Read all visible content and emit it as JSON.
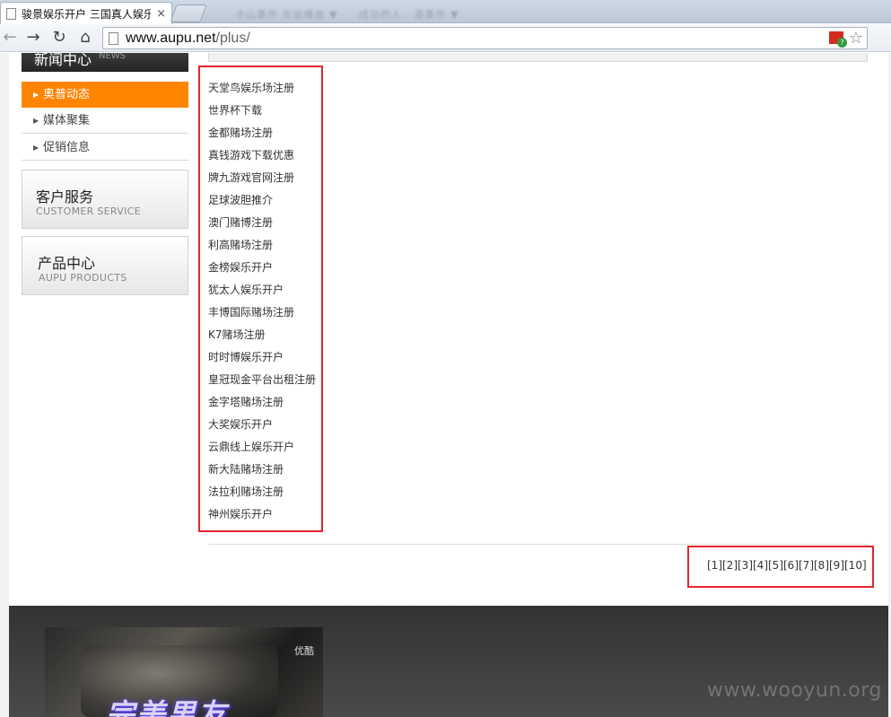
{
  "browser": {
    "tab_title": "骏景娱乐开户 三国真人娱乐",
    "tab_close": "×",
    "ghost_tabs": [
      "卡山事件 车运播放 ▼",
      "成功的人 · 道事件 ▼"
    ],
    "back": "←",
    "forward": "→",
    "reload": "↻",
    "home": "⌂",
    "url_host": "www.aupu.net",
    "url_path": "/plus/",
    "bookmark_star": "☆",
    "more": "»"
  },
  "sidebar": {
    "news_title": "新闻中心",
    "news_title_en": "NEWS",
    "items": [
      {
        "label": "奥普动态",
        "active": true
      },
      {
        "label": "媒体聚集",
        "active": false
      },
      {
        "label": "促销信息",
        "active": false
      }
    ],
    "service": {
      "title": "客户服务",
      "subtitle": "CUSTOMER SERVICE"
    },
    "products": {
      "title": "产品中心",
      "subtitle": "AUPU PRODUCTS"
    }
  },
  "links": [
    "天堂鸟娱乐场注册",
    "世界杯下载",
    "金都赌场注册",
    "真钱游戏下载优惠",
    "牌九游戏官网注册",
    "足球波胆推介",
    "澳门赌博注册",
    "利高赌场注册",
    "金榜娱乐开户",
    "犹太人娱乐开户",
    "丰博国际赌场注册",
    "K7赌场注册",
    "时时博娱乐开户",
    "皇冠现金平台出租注册",
    "金字塔赌场注册",
    "大奖娱乐开户",
    "云鼎线上娱乐开户",
    "新大陆赌场注册",
    "法拉利赌场注册",
    "神州娱乐开户"
  ],
  "pagination": [
    "[1]",
    "[2]",
    "[3]",
    "[4]",
    "[5]",
    "[6]",
    "[7]",
    "[8]",
    "[9]",
    "[10]"
  ],
  "footer": {
    "video_brand": "优酷",
    "video_caption": "完美男友"
  },
  "watermark": "www.wooyun.org",
  "colors": {
    "menu_active": "#ff8400",
    "highlight_box": "#e8232b",
    "footer_bg": "#333333"
  }
}
